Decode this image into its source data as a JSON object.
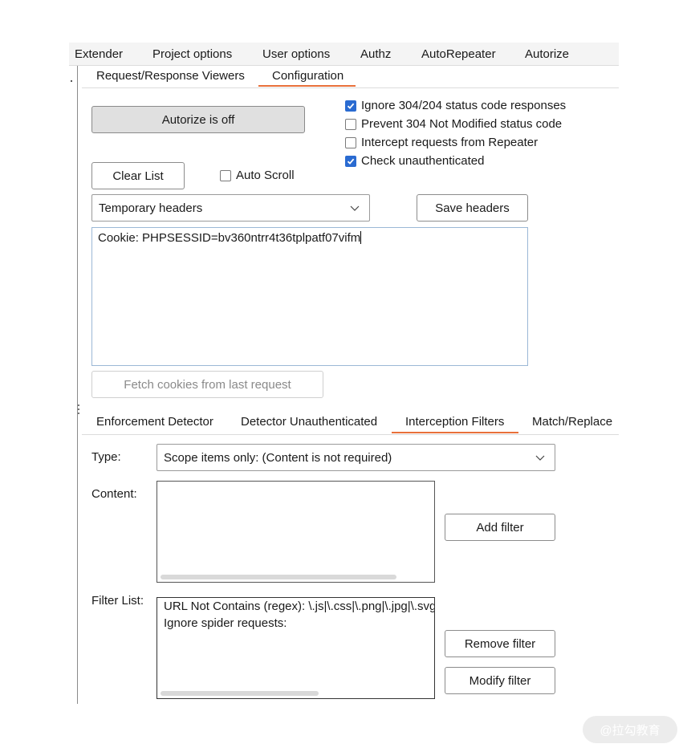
{
  "top_tabs": [
    {
      "label": "Extender"
    },
    {
      "label": "Project options"
    },
    {
      "label": "User options"
    },
    {
      "label": "Authz"
    },
    {
      "label": "AutoRepeater"
    },
    {
      "label": "Autorize",
      "active": true
    }
  ],
  "sub_tabs": [
    {
      "label": "Request/Response Viewers"
    },
    {
      "label": "Configuration",
      "active": true
    }
  ],
  "config": {
    "toggle_button": "Autorize is off",
    "clear_button": "Clear List",
    "auto_scroll_label": "Auto Scroll",
    "auto_scroll_checked": false,
    "options": [
      {
        "label": "Ignore 304/204 status code responses",
        "checked": true
      },
      {
        "label": "Prevent 304 Not Modified status code",
        "checked": false
      },
      {
        "label": "Intercept requests from Repeater",
        "checked": false
      },
      {
        "label": "Check unauthenticated",
        "checked": true
      }
    ],
    "headers_select": "Temporary headers",
    "save_headers_button": "Save headers",
    "headers_text": "Cookie: PHPSESSID=bv360ntrr4t36tplpatf07vifm",
    "fetch_cookies_button": "Fetch cookies from last request"
  },
  "lower_tabs": [
    {
      "label": "Enforcement Detector"
    },
    {
      "label": "Detector Unauthenticated"
    },
    {
      "label": "Interception Filters",
      "active": true
    },
    {
      "label": "Match/Replace"
    }
  ],
  "filters": {
    "type_label": "Type:",
    "type_value": "Scope items only: (Content is not required)",
    "content_label": "Content:",
    "add_filter_button": "Add filter",
    "filter_list_label": "Filter List:",
    "filter_items": [
      "URL Not Contains (regex): \\.js|\\.css|\\.png|\\.jpg|\\.svg",
      "Ignore spider requests:"
    ],
    "remove_filter_button": "Remove filter",
    "modify_filter_button": "Modify filter"
  },
  "watermark": "@拉勾教育",
  "colors": {
    "accent": "#e8703a",
    "checkbox": "#2a6bd1"
  }
}
